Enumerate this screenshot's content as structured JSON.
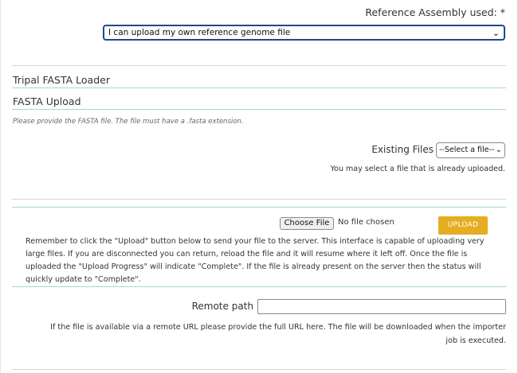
{
  "reference": {
    "label": "Reference Assembly used: *",
    "selected": "I can upload my own reference genome file"
  },
  "sections": {
    "loader_title": "Tripal FASTA Loader",
    "upload_title": "FASTA Upload",
    "help_text": "Please provide the FASTA file. The file must have a .fasta extension."
  },
  "existing": {
    "label": "Existing Files",
    "selected": "--Select a file--",
    "help": "You may select a file that is already uploaded."
  },
  "upload": {
    "choose_label": "Choose File",
    "no_file": "No file chosen",
    "upload_label": "UPLOAD",
    "description": "Remember to click the \"Upload\" button below to send your file to the server. This interface is capable of uploading very large files. If you are disconnected you can return, reload the file and it will resume where it left off. Once the file is uploaded the \"Upload Progress\" will indicate \"Complete\". If the file is already present on the server then the status will quickly update to \"Complete\"."
  },
  "remote": {
    "label": "Remote path",
    "value": "",
    "help": "If the file is available via a remote URL please provide the full URL here. The file will be downloaded when the importer job is executed."
  },
  "icons": {
    "select_chevron": "chevron-down-icon"
  }
}
